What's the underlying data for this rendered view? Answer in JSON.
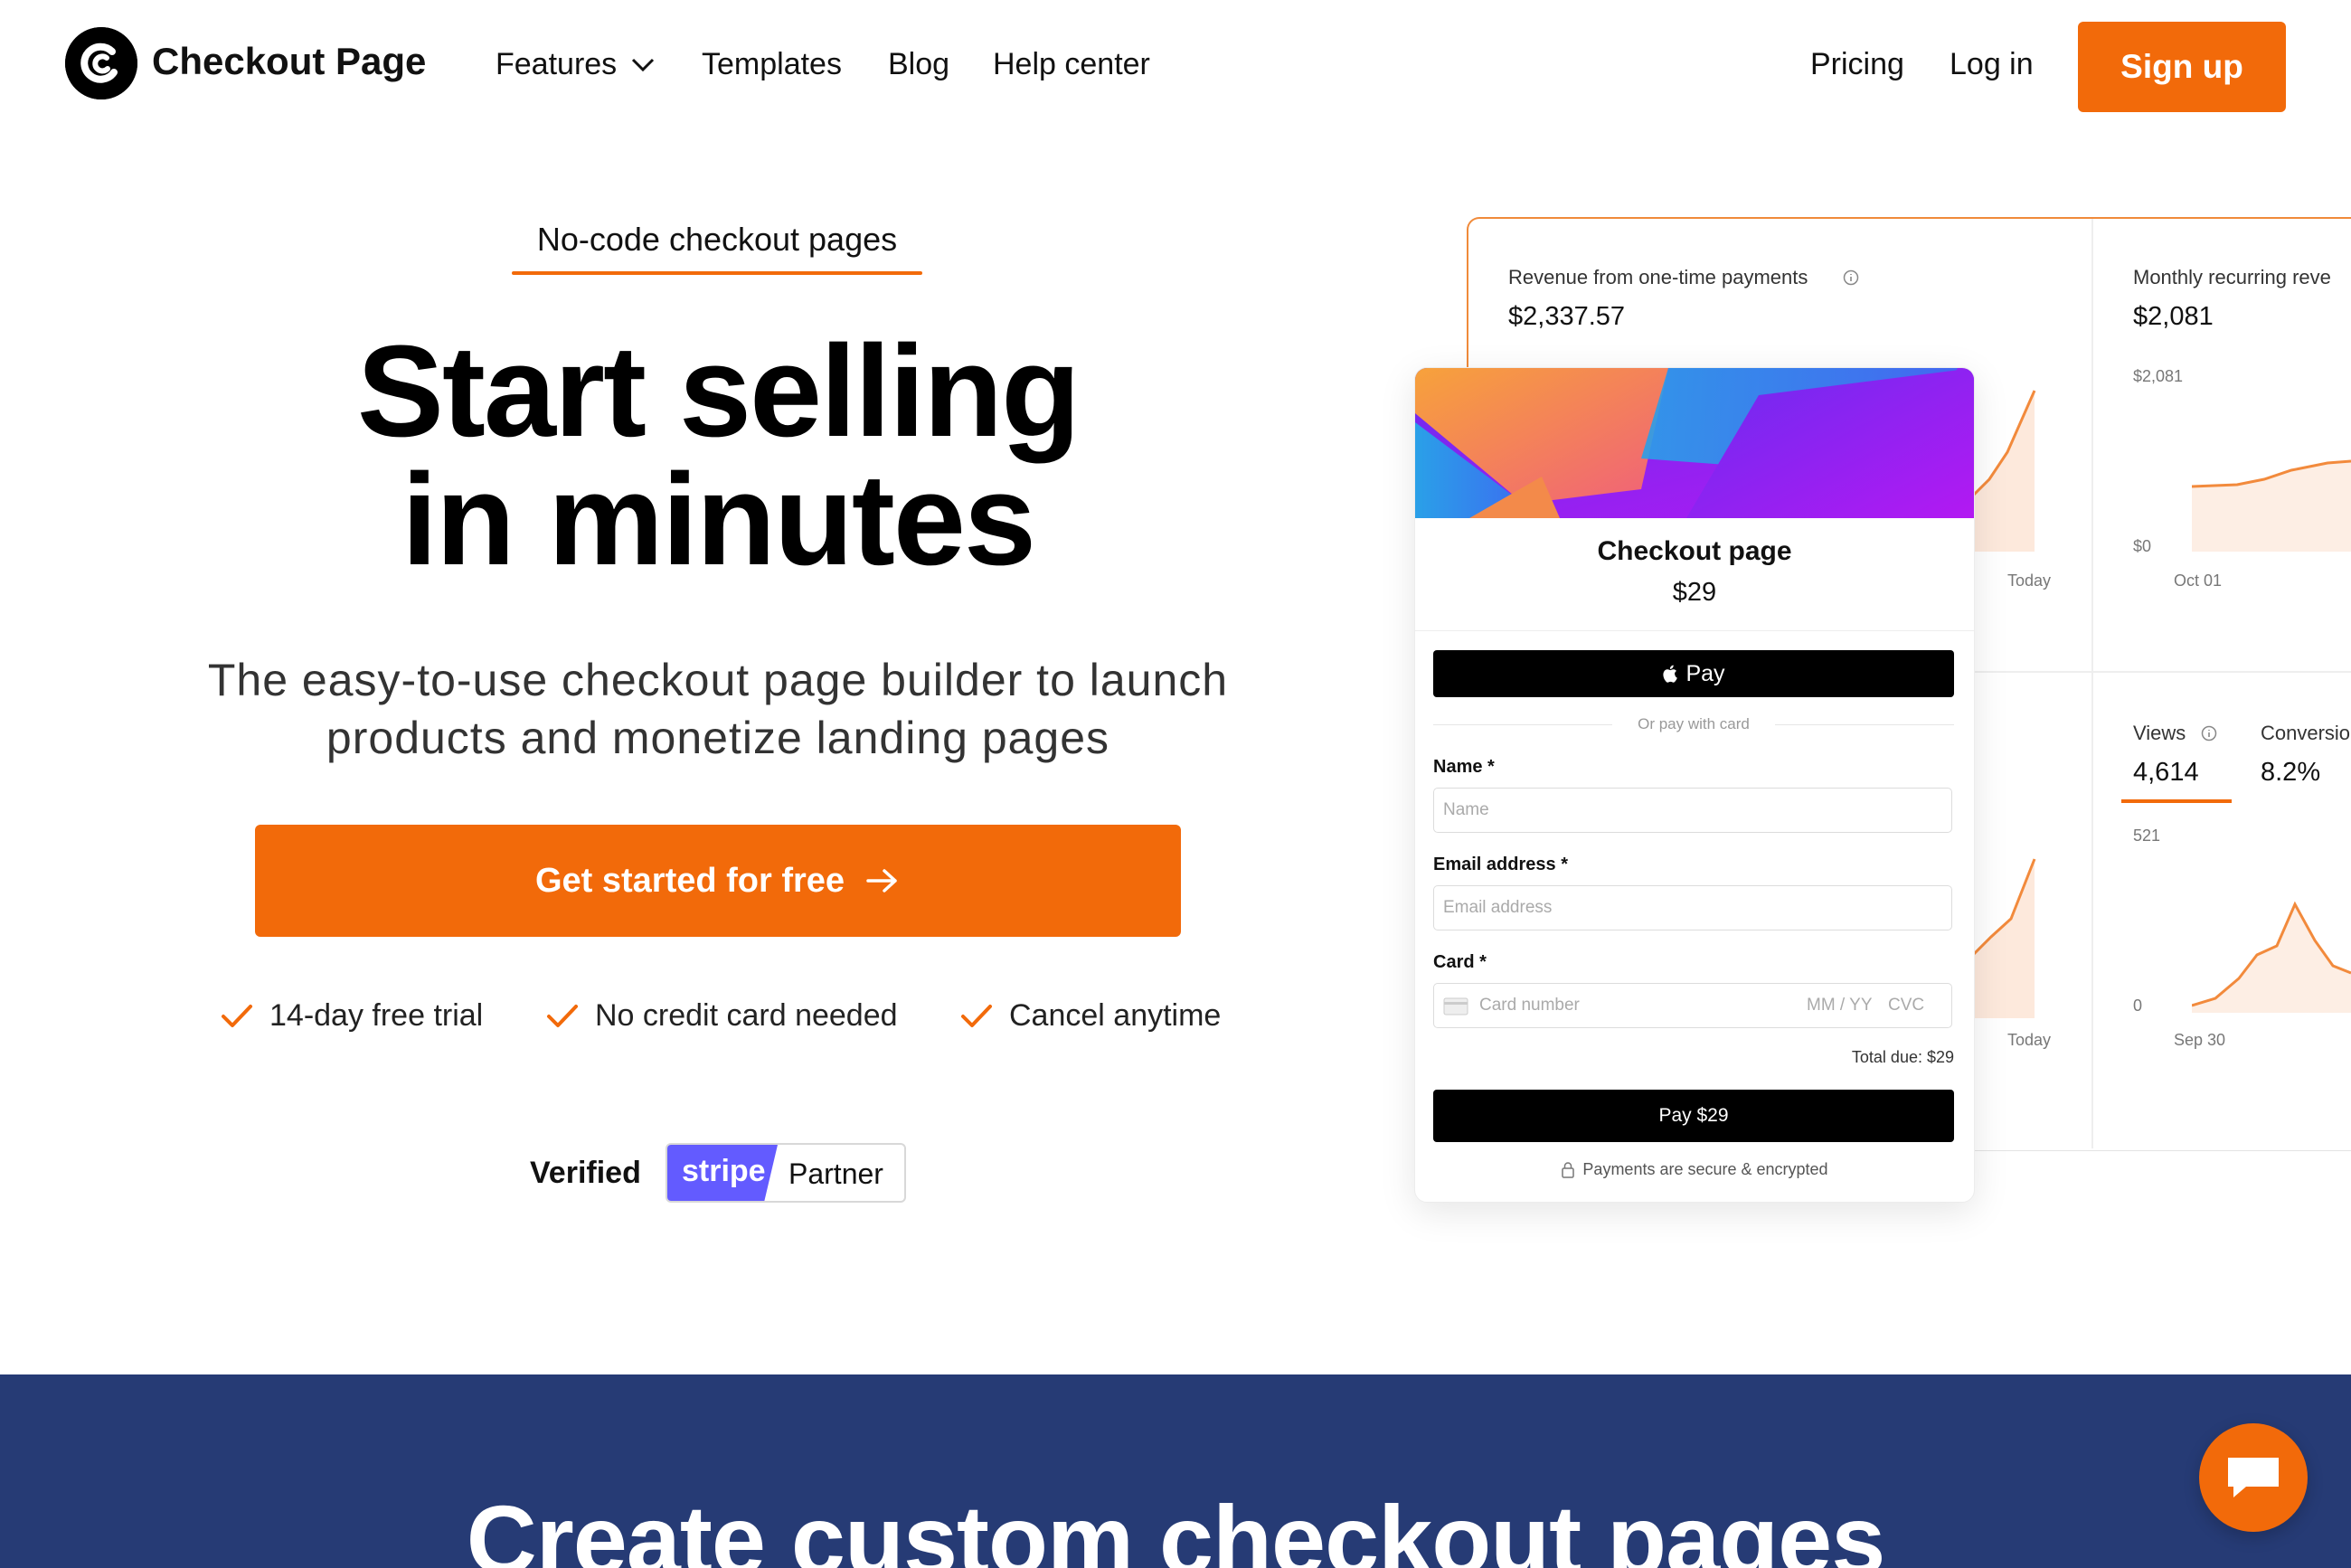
{
  "nav": {
    "brand": "Checkout Page",
    "features": "Features",
    "templates": "Templates",
    "blog": "Blog",
    "help_center": "Help center",
    "pricing": "Pricing",
    "login": "Log in",
    "signup": "Sign up"
  },
  "hero": {
    "eyebrow": "No-code checkout pages",
    "headline_line1": "Start selling",
    "headline_line2": "in minutes",
    "subhead_line1": "The easy-to-use checkout page builder to launch",
    "subhead_line2": "products and monetize landing pages",
    "cta": "Get started for free",
    "perks": [
      "14-day free trial",
      "No credit card needed",
      "Cancel anytime"
    ],
    "verified": "Verified",
    "stripe": "stripe",
    "partner": "Partner"
  },
  "dashboard": {
    "revenue": {
      "label": "Revenue from one-time payments",
      "value": "$2,337.57",
      "x_end": "Today"
    },
    "mrr": {
      "label": "Monthly recurring reve",
      "value": "$2,081",
      "y_max": "$2,081",
      "y_min": "$0",
      "x_start": "Oct 01"
    },
    "lower_left": {
      "x_end": "Today"
    },
    "views": {
      "label": "Views",
      "value": "4,614",
      "y_max": "521",
      "y_min": "0",
      "x_start": "Sep 30"
    },
    "conversion": {
      "label": "Conversio",
      "value": "8.2%"
    }
  },
  "checkout_card": {
    "title": "Checkout page",
    "price": "$29",
    "apple_pay": "Pay",
    "or_text": "Or pay with card",
    "name_label": "Name",
    "name_placeholder": "Name",
    "email_label": "Email address",
    "email_placeholder": "Email address",
    "card_label": "Card",
    "required_mark": "*",
    "card_number_placeholder": "Card number",
    "expiry_placeholder": "MM / YY",
    "cvc_placeholder": "CVC",
    "total": "Total due: $29",
    "pay_button": "Pay $29",
    "secure_text": "Payments are secure & encrypted"
  },
  "section2": {
    "title": "Create custom checkout pages"
  },
  "colors": {
    "accent": "#f26a0a",
    "band": "#263b75",
    "stripe": "#635bff"
  }
}
